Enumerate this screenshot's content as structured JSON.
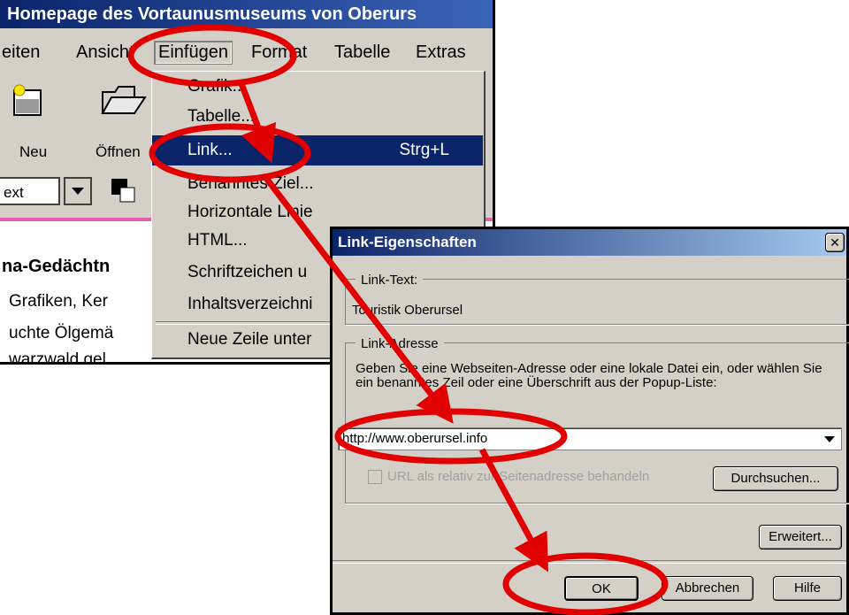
{
  "editor": {
    "title": "Homepage des Vortaunusmuseums von Oberurs",
    "menu": {
      "bearbeiten": "eiten",
      "ansicht": "Ansicht",
      "einfuegen": "Einfügen",
      "format": "Format",
      "tabelle": "Tabelle",
      "extras": "Extras"
    },
    "toolbar": {
      "neu": "Neu",
      "oeffnen": "Öffnen"
    },
    "format_combo": "ext",
    "doc_lines": [
      "na-Gedächtn",
      "Grafiken, Ker",
      "uchte Ölgemä",
      "warzwald gel"
    ]
  },
  "dropdown": {
    "items": [
      {
        "label": "Grafik..."
      },
      {
        "label": "Tabelle..."
      },
      {
        "label": "Link...",
        "shortcut": "Strg+L"
      },
      {
        "label": "Benanntes Ziel..."
      },
      {
        "label": "Horizontale Linie"
      },
      {
        "label": "HTML..."
      },
      {
        "label": "Schriftzeichen u"
      },
      {
        "label": "Inhaltsverzeichni"
      },
      {
        "label": "Neue Zeile unter"
      }
    ]
  },
  "dialog": {
    "title": "Link-Eigenschaften",
    "link_text_group": "Link-Text:",
    "link_text_value": "Touristik Oberursel",
    "link_address_group": "Link-Adresse",
    "instruction": "Geben Sie eine Webseiten-Adresse oder eine lokale Datei ein, oder wählen Sie ein benanntes Zeil oder eine Überschrift aus der Popup-Liste:",
    "url_value": "http://www.oberursel.info",
    "relative_checkbox": "URL als relativ zur Seitenadresse behandeln",
    "browse_button": "Durchsuchen...",
    "advanced_button": "Erweitert...",
    "ok_button": "OK",
    "cancel_button": "Abbrechen",
    "help_button": "Hilfe"
  },
  "colors": {
    "annotation": "#e00000",
    "highlight": "#0a246a",
    "face": "#d4d0c8"
  }
}
